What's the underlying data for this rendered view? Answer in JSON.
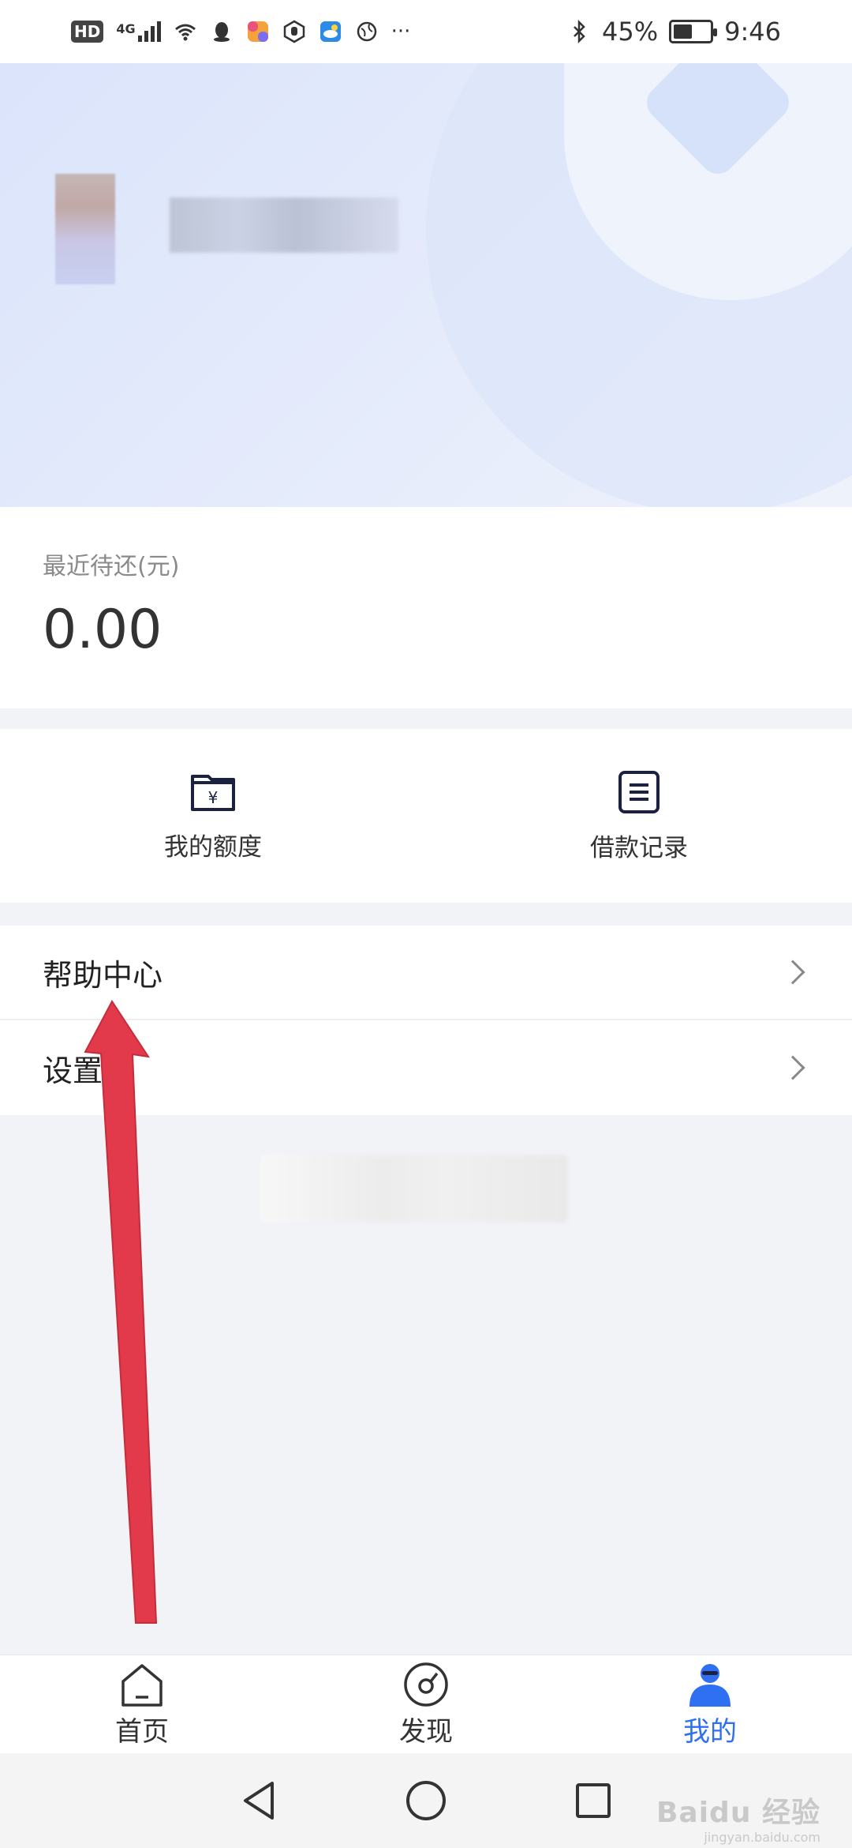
{
  "status_bar": {
    "left_badges": [
      "HD",
      "4G"
    ],
    "more": "···",
    "battery": "45%",
    "time": "9:46"
  },
  "repayment": {
    "label": "最近待还(元)",
    "value": "0.00"
  },
  "actions": [
    {
      "label": "我的额度",
      "icon": "wallet-yuan-icon"
    },
    {
      "label": "借款记录",
      "icon": "document-list-icon"
    }
  ],
  "menu": [
    {
      "label": "帮助中心"
    },
    {
      "label": "设置"
    }
  ],
  "tabbar": [
    {
      "label": "首页",
      "icon": "home-icon",
      "active": false
    },
    {
      "label": "发现",
      "icon": "discover-icon",
      "active": false
    },
    {
      "label": "我的",
      "icon": "profile-icon",
      "active": true
    }
  ],
  "watermark": {
    "text": "Baidu 经验",
    "sub": "jingyan.baidu.com"
  },
  "colors": {
    "accent": "#2f6ff1",
    "arrow": "#e23a4a",
    "header_bg": "#dde5fb"
  }
}
